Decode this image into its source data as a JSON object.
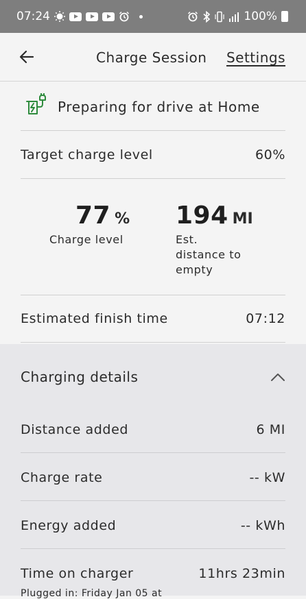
{
  "status_bar": {
    "time": "07:24",
    "battery": "100%",
    "left_icons": [
      "brightness-icon",
      "youtube-icon",
      "youtube-icon",
      "youtube-icon",
      "alarm-icon",
      "dot-icon"
    ],
    "right_icons": [
      "alarm-icon",
      "bluetooth-icon",
      "vibrate-icon",
      "signal-icon",
      "battery-icon"
    ]
  },
  "header": {
    "title": "Charge Session",
    "settings_label": "Settings"
  },
  "status": {
    "icon": "plug-charging-icon",
    "message": "Preparing for drive at Home"
  },
  "target": {
    "label": "Target charge level",
    "value": "60%"
  },
  "stats": {
    "charge_level": {
      "value": "77",
      "unit": "%",
      "label": "Charge level"
    },
    "distance": {
      "value": "194",
      "unit": "MI",
      "label_lines": [
        "Est.",
        "distance to",
        "empty"
      ]
    }
  },
  "finish": {
    "label": "Estimated finish time",
    "value": "07:12"
  },
  "details": {
    "title": "Charging details",
    "rows": [
      {
        "label": "Distance added",
        "value": "6 MI"
      },
      {
        "label": "Charge rate",
        "value": "-- kW"
      },
      {
        "label": "Energy added",
        "value": "-- kWh"
      },
      {
        "label": "Time on charger",
        "value": "11hrs 23min"
      }
    ],
    "plugged_in_note": "Plugged in: Friday Jan 05 at"
  },
  "colors": {
    "status_bar": "#7e7e7e",
    "background": "#f4f4f4",
    "details_background": "#e7e7ea",
    "plug_icon_green": "#2e8b3d"
  }
}
